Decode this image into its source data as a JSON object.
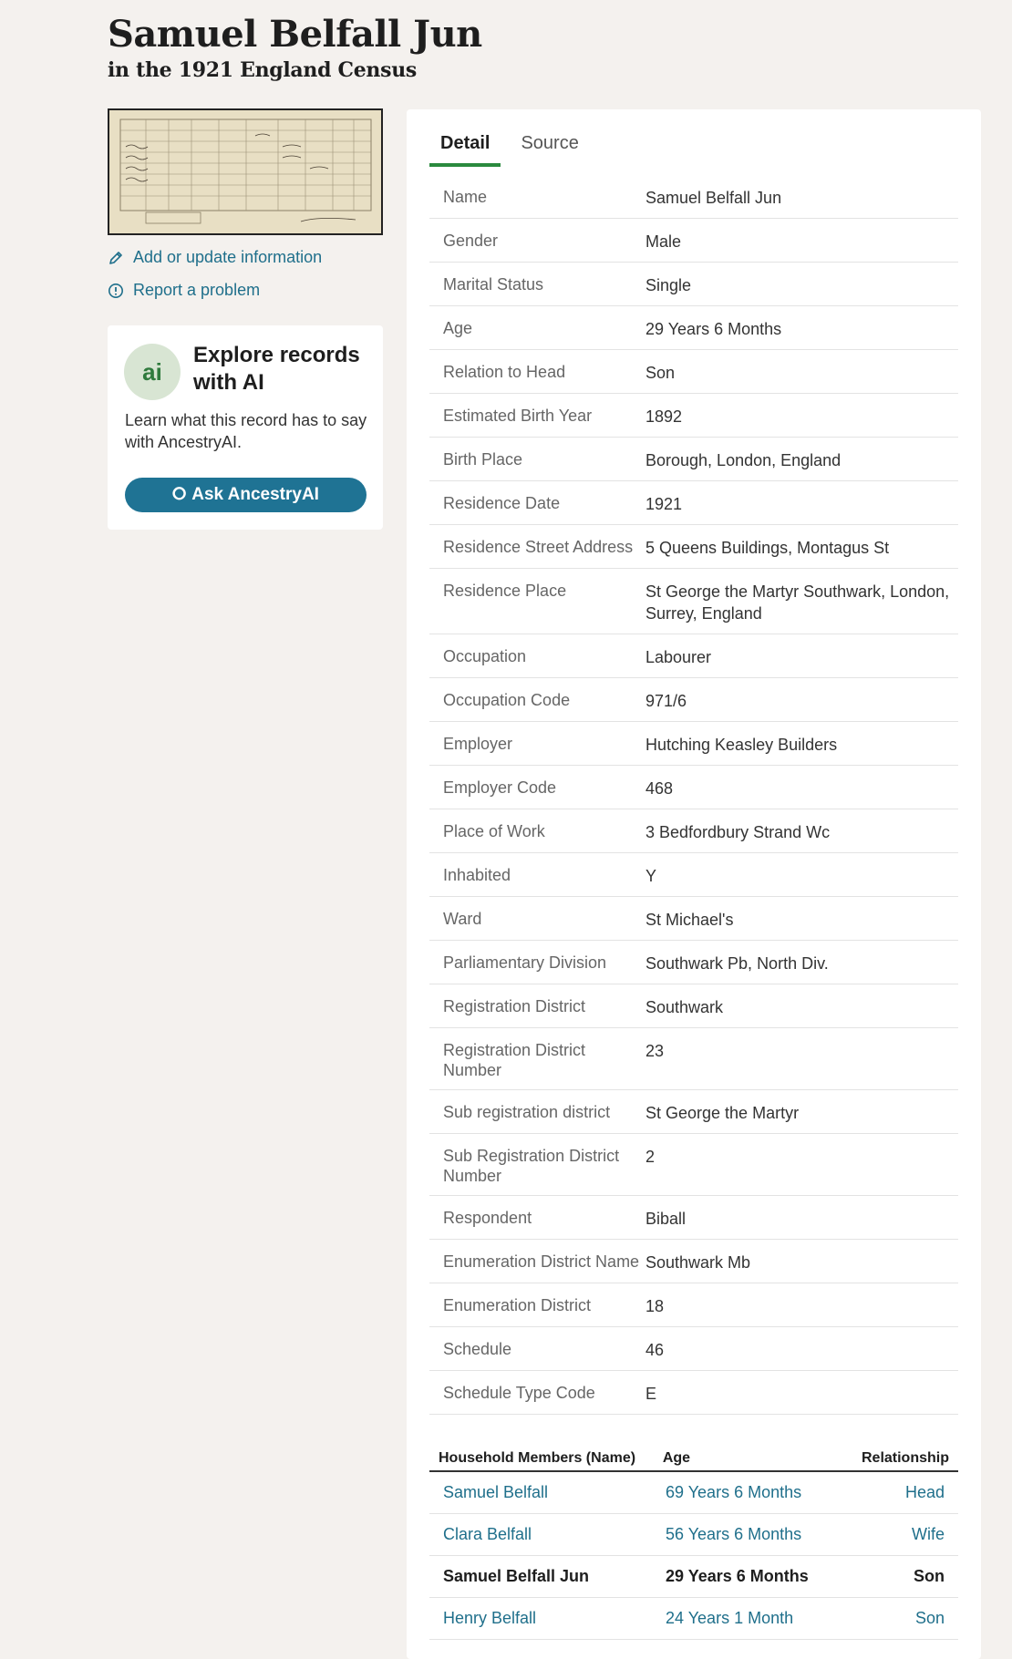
{
  "header": {
    "title": "Samuel Belfall Jun",
    "subtitle": "in the 1921 England Census"
  },
  "sidebar": {
    "add_link": "Add or update information",
    "report_link": "Report a problem",
    "ai_card": {
      "logo_text": "ai",
      "title": "Explore records with AI",
      "description": "Learn what this record has to say with AncestryAI.",
      "button_label": "Ask AncestryAI"
    }
  },
  "tabs": [
    "Detail",
    "Source"
  ],
  "details": [
    {
      "label": "Name",
      "value": "Samuel Belfall Jun"
    },
    {
      "label": "Gender",
      "value": "Male"
    },
    {
      "label": "Marital Status",
      "value": "Single"
    },
    {
      "label": "Age",
      "value": "29 Years 6 Months"
    },
    {
      "label": "Relation to Head",
      "value": "Son"
    },
    {
      "label": "Estimated Birth Year",
      "value": "1892"
    },
    {
      "label": "Birth Place",
      "value": "Borough, London, England"
    },
    {
      "label": "Residence Date",
      "value": "1921"
    },
    {
      "label": "Residence Street Address",
      "value": "5 Queens Buildings, Montagus St"
    },
    {
      "label": "Residence Place",
      "value": "St George the Martyr Southwark, London, Surrey, England"
    },
    {
      "label": "Occupation",
      "value": "Labourer"
    },
    {
      "label": "Occupation Code",
      "value": "971/6"
    },
    {
      "label": "Employer",
      "value": "Hutching Keasley Builders"
    },
    {
      "label": "Employer Code",
      "value": "468"
    },
    {
      "label": "Place of Work",
      "value": "3 Bedfordbury Strand Wc"
    },
    {
      "label": "Inhabited",
      "value": "Y"
    },
    {
      "label": "Ward",
      "value": "St Michael's"
    },
    {
      "label": "Parliamentary Division",
      "value": "Southwark Pb, North Div."
    },
    {
      "label": "Registration District",
      "value": "Southwark"
    },
    {
      "label": "Registration District Number",
      "value": "23"
    },
    {
      "label": "Sub registration district",
      "value": "St George the Martyr"
    },
    {
      "label": "Sub Registration District Number",
      "value": "2"
    },
    {
      "label": "Respondent",
      "value": "Biball"
    },
    {
      "label": "Enumeration District Name",
      "value": "Southwark Mb"
    },
    {
      "label": "Enumeration District",
      "value": "18"
    },
    {
      "label": "Schedule",
      "value": "46"
    },
    {
      "label": "Schedule Type Code",
      "value": "E"
    }
  ],
  "household": {
    "headers": {
      "name": "Household Members (Name)",
      "age": "Age",
      "relationship": "Relationship"
    },
    "members": [
      {
        "name": "Samuel Belfall",
        "age": "69 Years 6 Months",
        "relationship": "Head",
        "current": false
      },
      {
        "name": "Clara Belfall",
        "age": "56 Years 6 Months",
        "relationship": "Wife",
        "current": false
      },
      {
        "name": "Samuel Belfall Jun",
        "age": "29 Years 6 Months",
        "relationship": "Son",
        "current": true
      },
      {
        "name": "Henry Belfall",
        "age": "24 Years 1 Month",
        "relationship": "Son",
        "current": false
      }
    ]
  },
  "colors": {
    "accent_green": "#2a8a3e",
    "link_blue": "#1f6f8b",
    "button_blue": "#1f7394"
  }
}
